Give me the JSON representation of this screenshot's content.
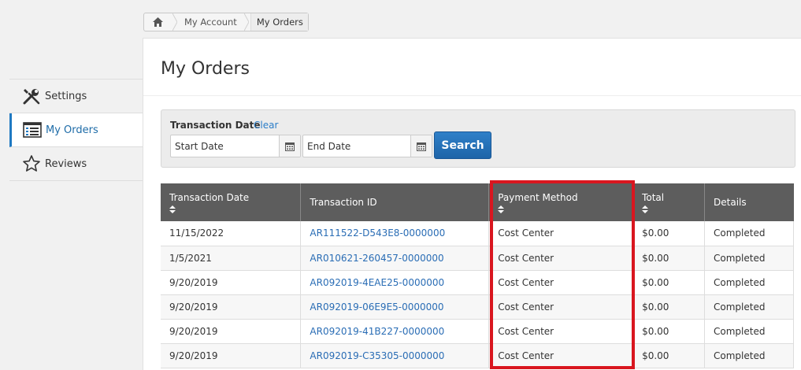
{
  "breadcrumb": {
    "items": [
      "My Account",
      "My Orders"
    ]
  },
  "sidebar": {
    "items": [
      {
        "label": "Settings",
        "icon": "wrench-screwdriver-icon"
      },
      {
        "label": "My Orders",
        "icon": "list-icon",
        "active": true
      },
      {
        "label": "Reviews",
        "icon": "star-icon"
      }
    ]
  },
  "main": {
    "title": "My Orders",
    "filter": {
      "label": "Transaction Date",
      "clear_label": "Clear",
      "start_placeholder": "Start Date",
      "end_placeholder": "End Date",
      "search_label": "Search"
    },
    "table": {
      "columns": [
        "Transaction Date",
        "Transaction ID",
        "Payment Method",
        "Total",
        "Details"
      ],
      "rows": [
        [
          "11/15/2022",
          "AR111522-D543E8-0000000",
          "Cost Center",
          "$0.00",
          "Completed"
        ],
        [
          "1/5/2021",
          "AR010621-260457-0000000",
          "Cost Center",
          "$0.00",
          "Completed"
        ],
        [
          "9/20/2019",
          "AR092019-4EAE25-0000000",
          "Cost Center",
          "$0.00",
          "Completed"
        ],
        [
          "9/20/2019",
          "AR092019-06E9E5-0000000",
          "Cost Center",
          "$0.00",
          "Completed"
        ],
        [
          "9/20/2019",
          "AR092019-41B227-0000000",
          "Cost Center",
          "$0.00",
          "Completed"
        ],
        [
          "9/20/2019",
          "AR092019-C35305-0000000",
          "Cost Center",
          "$0.00",
          "Completed"
        ]
      ]
    }
  },
  "colors": {
    "accent": "#1f79c2",
    "header_bg": "#5d5d5d",
    "highlight": "#d9161f"
  }
}
